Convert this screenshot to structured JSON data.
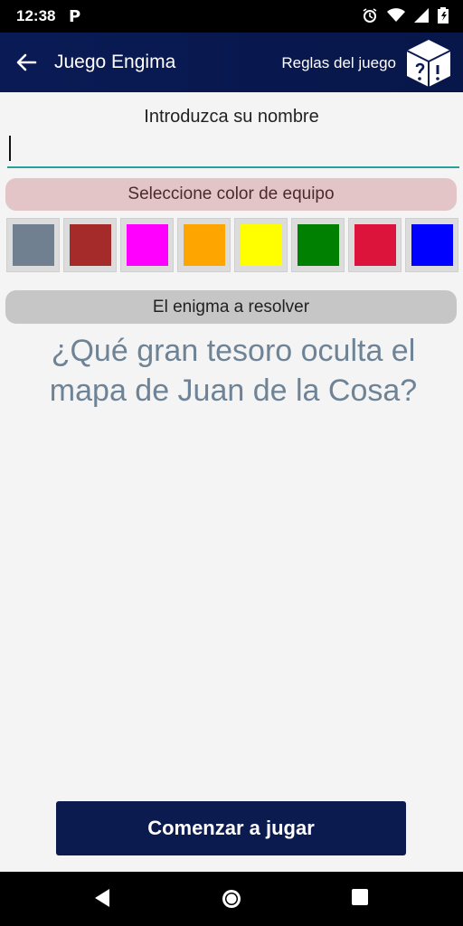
{
  "status": {
    "time": "12:38",
    "app_icon": "P"
  },
  "appbar": {
    "title": "Juego Engima",
    "rules_link": "Reglas del juego"
  },
  "form": {
    "name_label": "Introduzca su nombre",
    "name_value": "",
    "team_color_label": "Seleccione color de equipo",
    "colors": [
      "#708090",
      "#a52a2a",
      "#ff00ff",
      "#ffa500",
      "#ffff00",
      "#008000",
      "#dc143c",
      "#0000ff"
    ]
  },
  "enigma": {
    "label": "El enigma a resolver",
    "question": "¿Qué gran tesoro oculta el mapa de Juan de la Cosa?"
  },
  "actions": {
    "start_label": "Comenzar a jugar"
  },
  "icons": [
    "back-arrow-icon",
    "dice-icon",
    "alarm-icon",
    "wifi-icon",
    "signal-icon",
    "battery-icon",
    "nav-back-icon",
    "nav-home-icon",
    "nav-recents-icon"
  ]
}
